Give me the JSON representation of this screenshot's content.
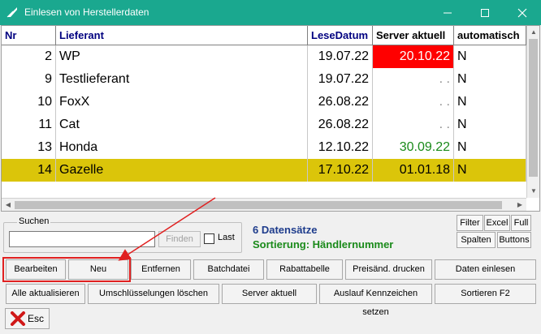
{
  "window": {
    "title": "Einlesen von Herstellerdaten",
    "accent_color": "#1aa88f",
    "icons": {
      "app": "app-logo-icon",
      "minimize": "minimize-icon",
      "maximize": "maximize-icon",
      "close": "close-icon"
    }
  },
  "grid": {
    "columns": [
      "Nr",
      "Lieferant",
      "LeseDatum",
      "Server aktuell",
      "automatisch"
    ],
    "rows": [
      {
        "nr": "2",
        "lieferant": "WP",
        "lesedatum": "19.07.22",
        "server": "20.10.22",
        "auto": "N",
        "server_style": "red"
      },
      {
        "nr": "9",
        "lieferant": "Testlieferant",
        "lesedatum": "19.07.22",
        "server": ". .",
        "auto": "N",
        "server_style": "empty"
      },
      {
        "nr": "10",
        "lieferant": "FoxX",
        "lesedatum": "26.08.22",
        "server": ". .",
        "auto": "N",
        "server_style": "empty"
      },
      {
        "nr": "11",
        "lieferant": "Cat",
        "lesedatum": "26.08.22",
        "server": ". .",
        "auto": "N",
        "server_style": "empty"
      },
      {
        "nr": "13",
        "lieferant": "Honda",
        "lesedatum": "12.10.22",
        "server": "30.09.22",
        "auto": "N",
        "server_style": "green"
      },
      {
        "nr": "14",
        "lieferant": "Gazelle",
        "lesedatum": "17.10.22",
        "server": "01.01.18",
        "auto": "N",
        "server_style": "normal",
        "selected": true
      }
    ],
    "selected_color": "#dbc50a"
  },
  "search": {
    "group_label": "Suchen",
    "value": "",
    "find_label": "Finden",
    "last_label": "Last",
    "last_checked": false
  },
  "status": {
    "count": "6 Datensätze",
    "sort": "Sortierung: Händlernummer"
  },
  "side_buttons": {
    "filter": "Filter",
    "excel": "Excel",
    "full": "Full",
    "spalten": "Spalten",
    "buttons": "Buttons"
  },
  "buttons_row1": {
    "bearbeiten": "Bearbeiten",
    "neu": "Neu",
    "entfernen": "Entfernen",
    "batchdatei": "Batchdatei",
    "rabattabelle": "Rabattabelle",
    "preisaend": "Preisänd. drucken",
    "daten_einlesen": "Daten einlesen"
  },
  "buttons_row2": {
    "alle_aktualisieren": "Alle aktualisieren",
    "umschluesselungen": "Umschlüsselungen löschen",
    "server_aktuell": "Server aktuell",
    "auslauf": "Auslauf Kennzeichen setzen",
    "sortieren": "Sortieren F2"
  },
  "esc": {
    "label": "Esc",
    "icon": "red-x-icon"
  },
  "annotation_color": "#e02020"
}
